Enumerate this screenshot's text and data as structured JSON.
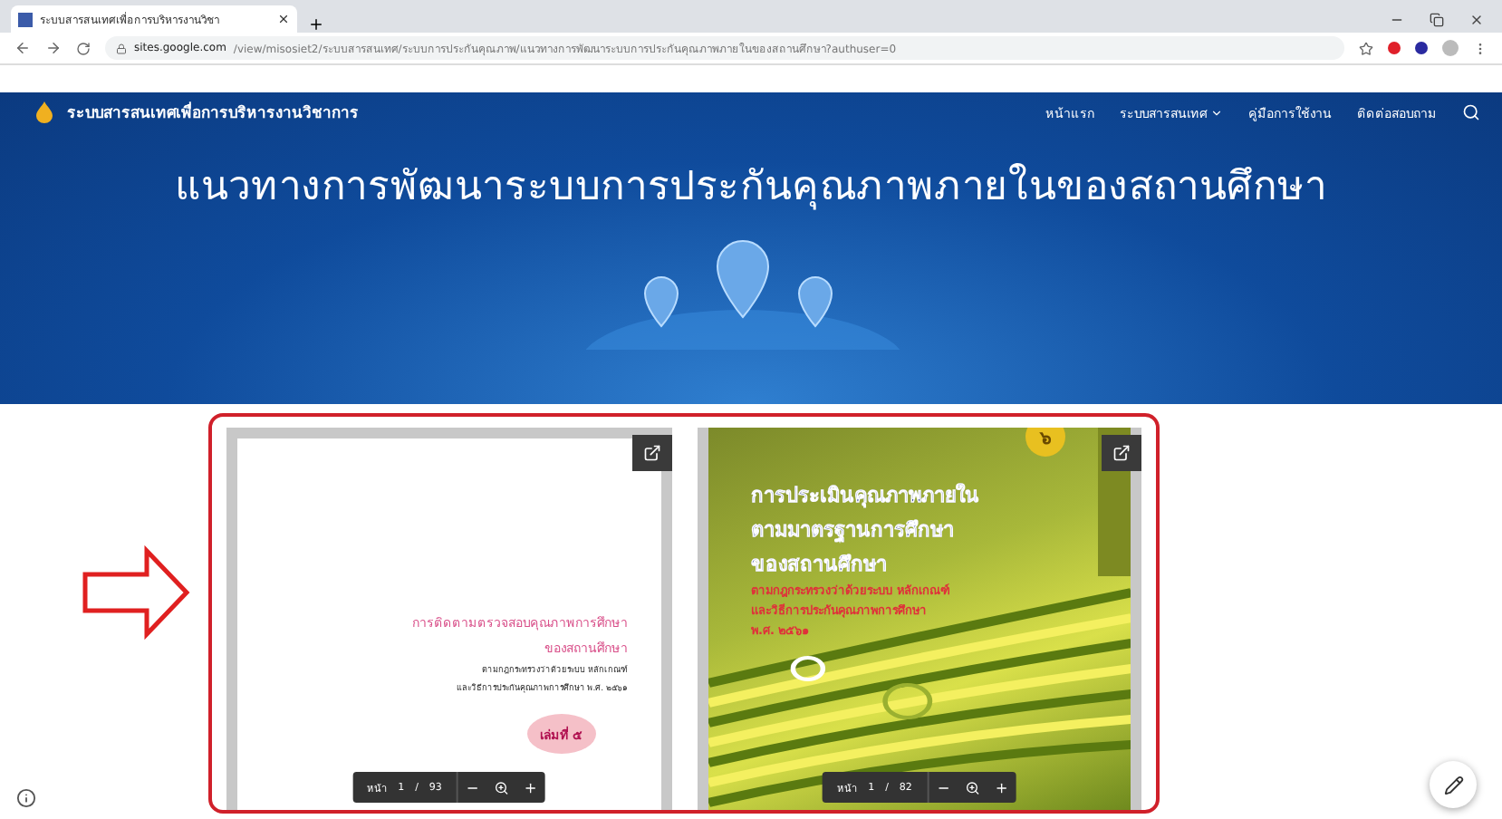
{
  "browser": {
    "tab_title": "ระบบสารสนเทศเพื่อการบริหารงานวิชา",
    "url_host": "sites.google.com",
    "url_path": "/view/misosiet2/ระบบสารสนเทศ/ระบบการประกันคุณภาพ/แนวทางการพัฒนาระบบการประกันคุณภาพภายในของสถานศึกษา?authuser=0"
  },
  "site": {
    "title": "ระบบสารสนเทศเพื่อการบริหารงานวิชาการ",
    "nav": [
      {
        "label": "หน้าแรก",
        "dropdown": false
      },
      {
        "label": "ระบบสารสนเทศ",
        "dropdown": true
      },
      {
        "label": "คู่มือการใช้งาน",
        "dropdown": false
      },
      {
        "label": "ติดต่อสอบถาม",
        "dropdown": false
      }
    ]
  },
  "hero": {
    "title": "แนวทางการพัฒนาระบบการประกันคุณภาพภายในของสถานศึกษา"
  },
  "documents": [
    {
      "kind": "plain",
      "headings": [
        "การติดตามตรวจสอบคุณภาพการศึกษา",
        "ของสถานศึกษา"
      ],
      "sublines": [
        "ตามกฎกระทรวงว่าด้วยระบบ หลักเกณฑ์",
        "และวิธีการประกันคุณภาพการศึกษา พ.ศ. ๒๕๖๑"
      ],
      "badge": "เล่มที่ ๕",
      "page_label": "หน้า",
      "page": "1",
      "separator": "/",
      "pages": "93"
    },
    {
      "kind": "cover",
      "headings": [
        "การประเมินคุณภาพภายใน",
        "ตามมาตรฐานการศึกษา",
        "ของสถานศึกษา"
      ],
      "sublines": [
        "ตามกฎกระทรวงว่าด้วยระบบ หลักเกณฑ์",
        "และวิธีการประกันคุณภาพการศึกษา",
        "พ.ศ. ๒๕๖๑"
      ],
      "badge": "๖",
      "page_label": "หน้า",
      "page": "1",
      "separator": "/",
      "pages": "82"
    }
  ]
}
